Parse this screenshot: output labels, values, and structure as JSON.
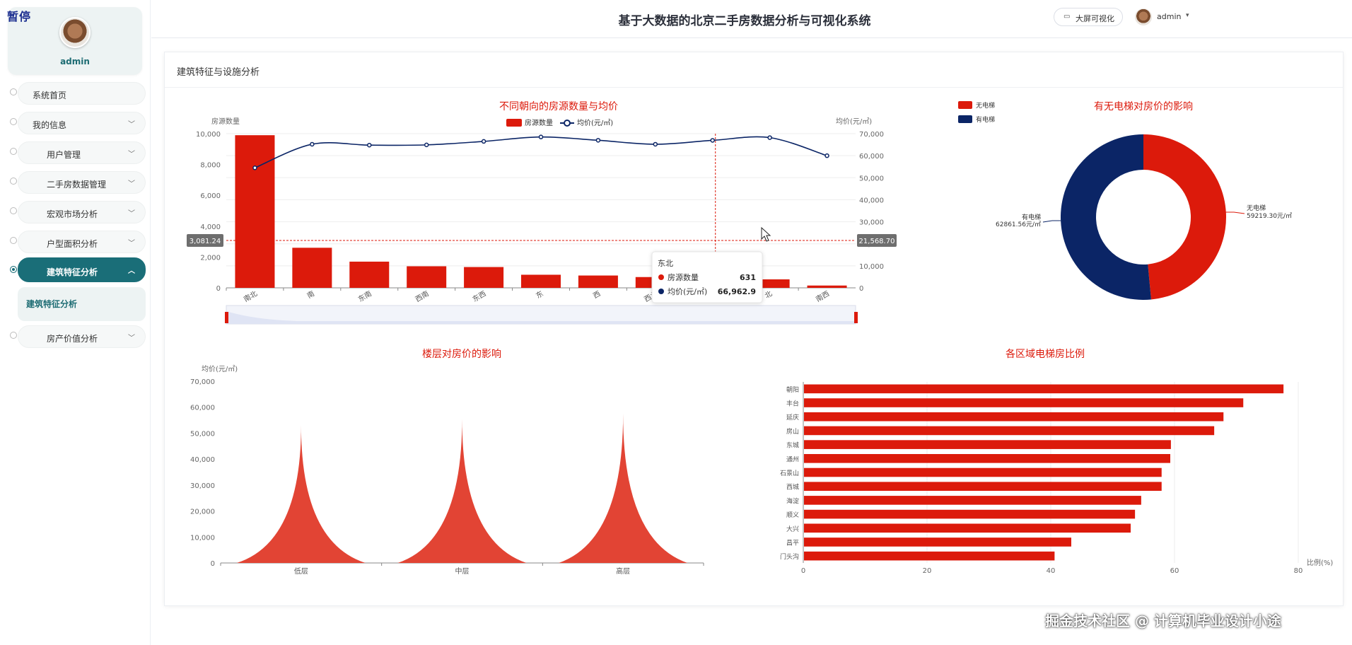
{
  "brand_tag": "暂停",
  "profile": {
    "name": "admin"
  },
  "menu": [
    {
      "label": "系统首页",
      "has_chevron": false,
      "active": false
    },
    {
      "label": "我的信息",
      "has_chevron": true,
      "active": false
    },
    {
      "label": "用户管理",
      "has_chevron": true,
      "active": false
    },
    {
      "label": "二手房数据管理",
      "has_chevron": true,
      "active": false
    },
    {
      "label": "宏观市场分析",
      "has_chevron": true,
      "active": false
    },
    {
      "label": "户型面积分析",
      "has_chevron": true,
      "active": false
    },
    {
      "label": "建筑特征分析",
      "has_chevron": true,
      "active": true
    },
    {
      "label": "房产价值分析",
      "has_chevron": true,
      "active": false
    }
  ],
  "submenu": {
    "label": "建筑特征分析"
  },
  "header": {
    "title": "基于大数据的北京二手房数据分析与可视化系统",
    "screen_button": "大屏可视化",
    "user": "admin"
  },
  "panel": {
    "title": "建筑特征与设施分析"
  },
  "watermark": "掘金技术社区 @ 计算机毕业设计小途",
  "colors": {
    "red": "#dc1a0b",
    "navy": "#0b2566",
    "teal": "#1a6e78",
    "floor": "#e24434"
  },
  "chart_data": [
    {
      "type": "bar-line",
      "title": "不同朝向的房源数量与均价",
      "legend": [
        "房源数量",
        "均价(元/㎡)"
      ],
      "ylabel_left": "房源数量",
      "ylabel_right": "均价(元/㎡)",
      "ylim_left": [
        0,
        10000
      ],
      "ylim_right": [
        0,
        70000
      ],
      "left_ticks": [
        "0",
        "2,000",
        "4,000",
        "6,000",
        "8,000",
        "10,000"
      ],
      "right_ticks": [
        "0",
        "10,000",
        "20,000",
        "30,000",
        "40,000",
        "50,000",
        "60,000",
        "70,000"
      ],
      "categories": [
        "南北",
        "南",
        "东南",
        "西南",
        "东西",
        "东",
        "西",
        "西北",
        "东北",
        "北",
        "南西"
      ],
      "series": [
        {
          "name": "房源数量",
          "values": [
            9900,
            2600,
            1700,
            1400,
            1350,
            850,
            800,
            700,
            631,
            550,
            150
          ]
        },
        {
          "name": "均价(元/㎡)",
          "values": [
            54500,
            65200,
            64800,
            64900,
            66500,
            68500,
            67000,
            65200,
            66962.9,
            68200,
            60000
          ]
        }
      ],
      "crosshair": {
        "left_value": "3,081.24",
        "right_value": "21,568.70"
      },
      "tooltip": {
        "title": "东北",
        "rows": [
          {
            "name": "房源数量",
            "value": "631"
          },
          {
            "name": "均价(元/㎡)",
            "value": "66,962.9"
          }
        ]
      }
    },
    {
      "type": "pie",
      "title": "有无电梯对房价的影响",
      "legend": [
        "无电梯",
        "有电梯"
      ],
      "slices": [
        {
          "name": "无电梯",
          "value": 59219.3,
          "label": "59219.30元/㎡"
        },
        {
          "name": "有电梯",
          "value": 62861.56,
          "label": "62861.56元/㎡"
        }
      ]
    },
    {
      "type": "pictorial-bar",
      "title": "楼层对房价的影响",
      "ylabel": "均价(元/㎡)",
      "ylim": [
        0,
        70000
      ],
      "y_ticks": [
        "0",
        "10,000",
        "20,000",
        "30,000",
        "40,000",
        "50,000",
        "60,000",
        "70,000"
      ],
      "categories": [
        "低层",
        "中层",
        "高层"
      ],
      "values": [
        53000,
        55500,
        57500
      ]
    },
    {
      "type": "bar",
      "orientation": "horizontal",
      "title": "各区域电梯房比例",
      "xlabel": "比例(%)",
      "xlim": [
        0,
        80
      ],
      "x_ticks": [
        "0",
        "20",
        "40",
        "60",
        "80"
      ],
      "categories": [
        "朝阳",
        "丰台",
        "延庆",
        "房山",
        "东城",
        "通州",
        "石景山",
        "西城",
        "海淀",
        "顺义",
        "大兴",
        "昌平",
        "门头沟"
      ],
      "values": [
        77.5,
        71.0,
        67.8,
        66.3,
        59.3,
        59.2,
        57.8,
        57.8,
        54.5,
        53.5,
        52.8,
        43.2,
        40.5
      ]
    }
  ]
}
